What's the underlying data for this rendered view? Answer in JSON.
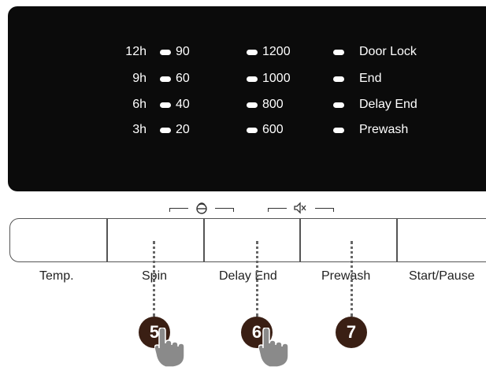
{
  "display": {
    "time_column": [
      "12h",
      "9h",
      "6h",
      "3h"
    ],
    "temp_column": [
      "90",
      "60",
      "40",
      "20"
    ],
    "spin_column": [
      "1200",
      "1000",
      "800",
      "600"
    ],
    "status_column": [
      "Door Lock",
      "End",
      "Delay End",
      "Prewash"
    ]
  },
  "buttons": [
    {
      "label": "Temp."
    },
    {
      "label": "Spin"
    },
    {
      "label": "Delay End"
    },
    {
      "label": "Prewash"
    },
    {
      "label": "Start/Pause"
    }
  ],
  "callouts": [
    {
      "number": "5",
      "has_hand": true
    },
    {
      "number": "6",
      "has_hand": true
    },
    {
      "number": "7",
      "has_hand": false
    }
  ],
  "icons": {
    "child_lock": "child-lock-icon",
    "mute": "speaker-mute-icon"
  },
  "colors": {
    "display_bg": "#0b0b0b",
    "badge": "#3a1f14",
    "hand": "#8a8a8a"
  }
}
